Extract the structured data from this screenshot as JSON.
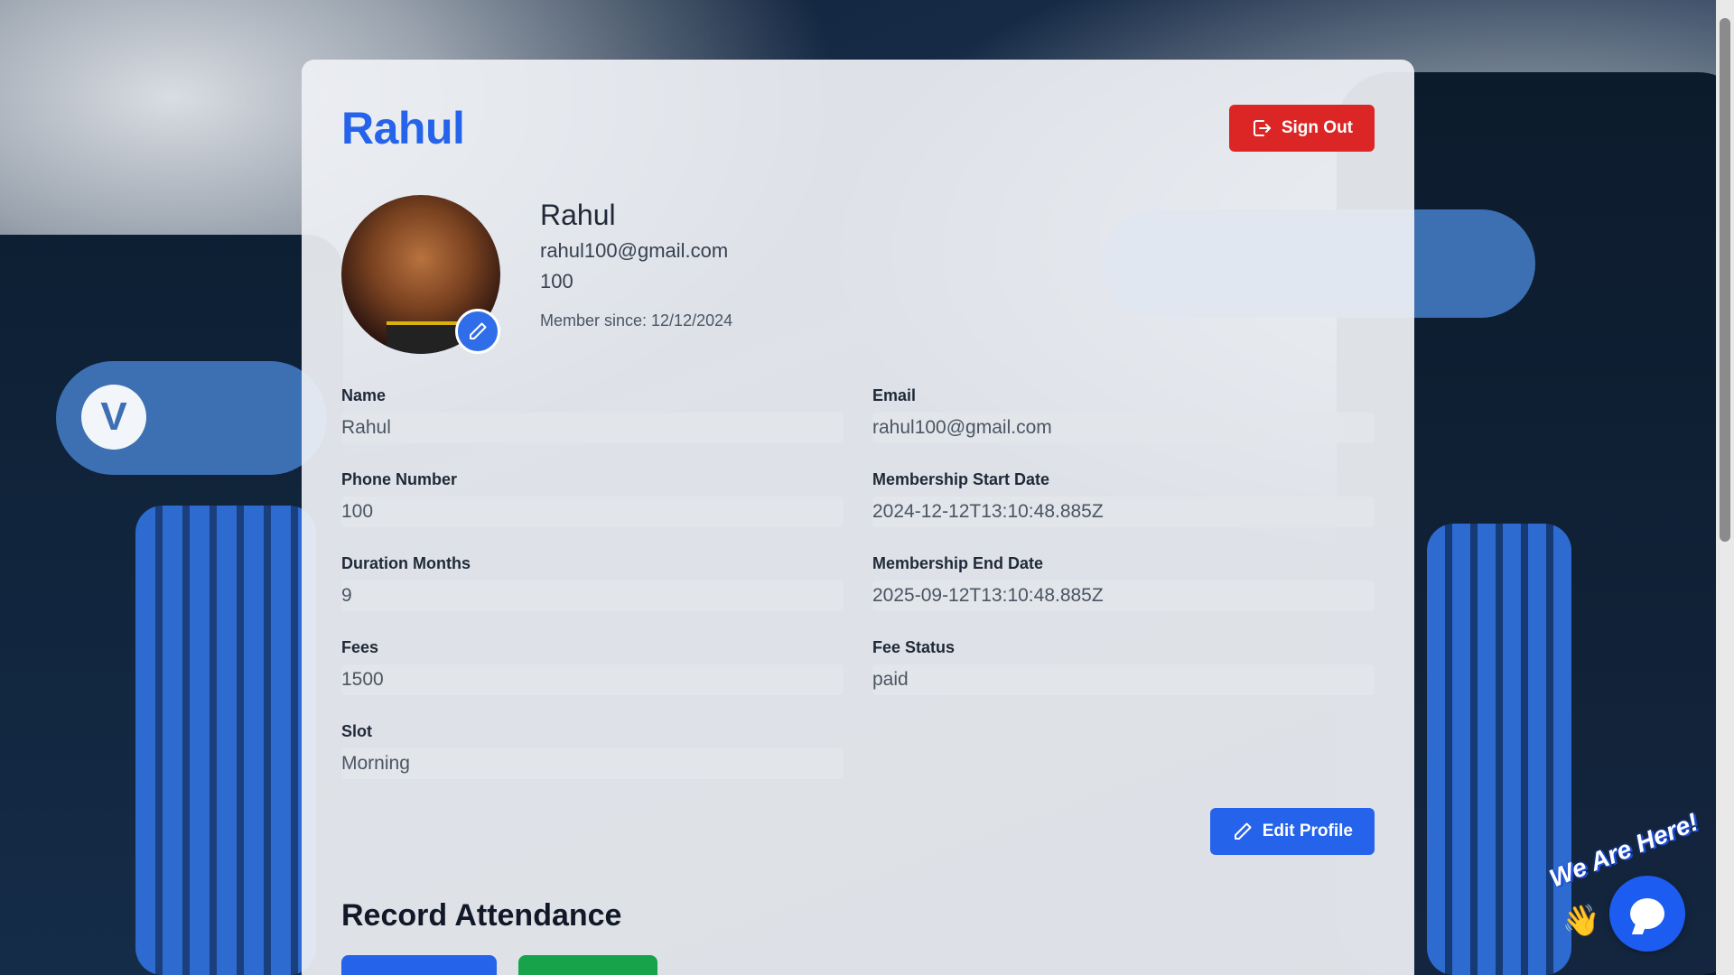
{
  "header": {
    "brand": "Rahul",
    "sign_out_label": "Sign Out"
  },
  "profile": {
    "name": "Rahul",
    "email": "rahul100@gmail.com",
    "phone": "100",
    "member_since": "Member since: 12/12/2024"
  },
  "fields": {
    "name": {
      "label": "Name",
      "value": "Rahul"
    },
    "email": {
      "label": "Email",
      "value": "rahul100@gmail.com"
    },
    "phone": {
      "label": "Phone Number",
      "value": "100"
    },
    "start_date": {
      "label": "Membership Start Date",
      "value": "2024-12-12T13:10:48.885Z"
    },
    "duration": {
      "label": "Duration Months",
      "value": "9"
    },
    "end_date": {
      "label": "Membership End Date",
      "value": "2025-09-12T13:10:48.885Z"
    },
    "fees": {
      "label": "Fees",
      "value": "1500"
    },
    "fee_status": {
      "label": "Fee Status",
      "value": "paid"
    },
    "slot": {
      "label": "Slot",
      "value": "Morning"
    }
  },
  "actions": {
    "edit_profile_label": "Edit Profile"
  },
  "attendance": {
    "title": "Record Attendance"
  },
  "chat": {
    "tagline": "We Are Here!",
    "wave_icon": "waving-hand-icon"
  },
  "colors": {
    "brand_blue": "#2563eb",
    "sign_out_red": "#dc2626",
    "attendance_green": "#16a34a"
  }
}
